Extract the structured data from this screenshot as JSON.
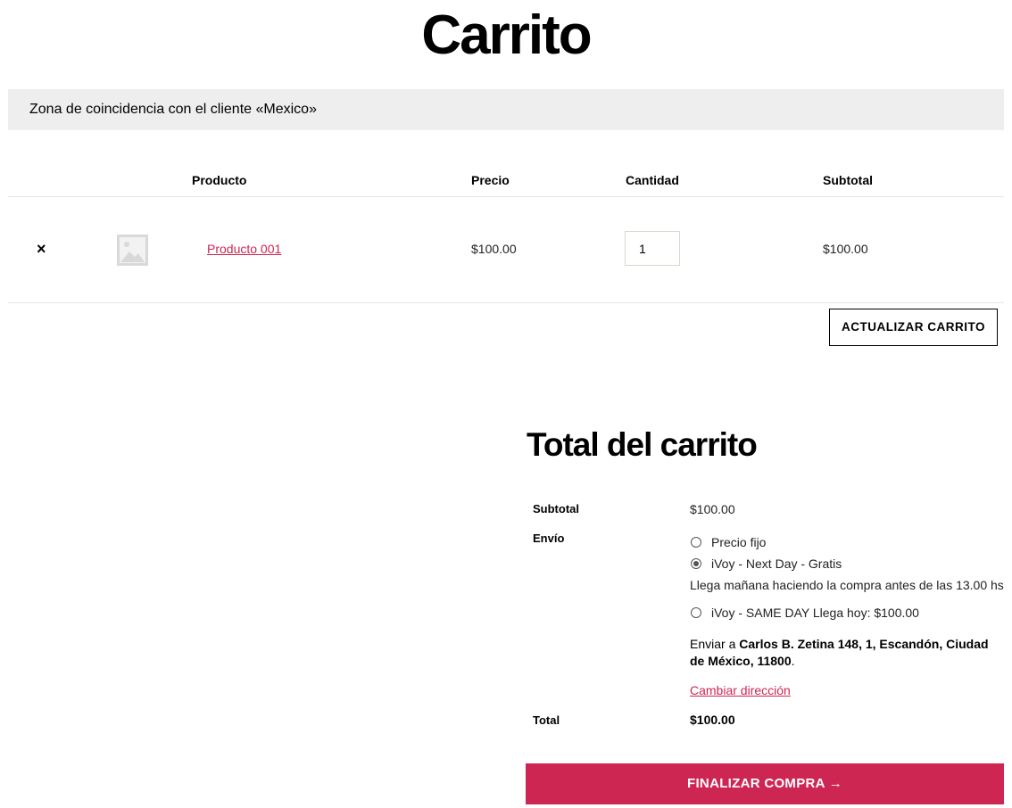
{
  "page": {
    "title": "Carrito"
  },
  "notice": {
    "text": "Zona de coincidencia con el cliente «Mexico»"
  },
  "cart_table": {
    "headers": {
      "product": "Producto",
      "price": "Precio",
      "quantity": "Cantidad",
      "subtotal": "Subtotal"
    },
    "items": [
      {
        "remove_label": "×",
        "thumbnail_icon": "image-placeholder-icon",
        "name": "Producto 001",
        "price": "$100.00",
        "quantity": "1",
        "subtotal": "$100.00"
      }
    ],
    "update_button": "ACTUALIZAR CARRITO"
  },
  "totals": {
    "title": "Total del carrito",
    "subtotal_label": "Subtotal",
    "subtotal_value": "$100.00",
    "shipping_label": "Envío",
    "shipping_options": [
      {
        "label": "Precio fijo",
        "checked": false
      },
      {
        "label": "iVoy - Next Day - Gratis",
        "checked": true,
        "note": "Llega mañana haciendo la compra antes de las 13.00 hs"
      },
      {
        "label": "iVoy - SAME DAY Llega hoy: $100.00",
        "checked": false
      }
    ],
    "ship_to_prefix": "Enviar a",
    "ship_to_address": "Carlos B. Zetina 148, 1, Escandón, Ciudad de México, 11800",
    "ship_to_suffix": ".",
    "change_address": "Cambiar dirección",
    "total_label": "Total",
    "total_value": "$100.00",
    "checkout_button": "FINALIZAR COMPRA →"
  },
  "colors": {
    "accent": "#cd2653",
    "notice_bg": "#eeeeee"
  }
}
